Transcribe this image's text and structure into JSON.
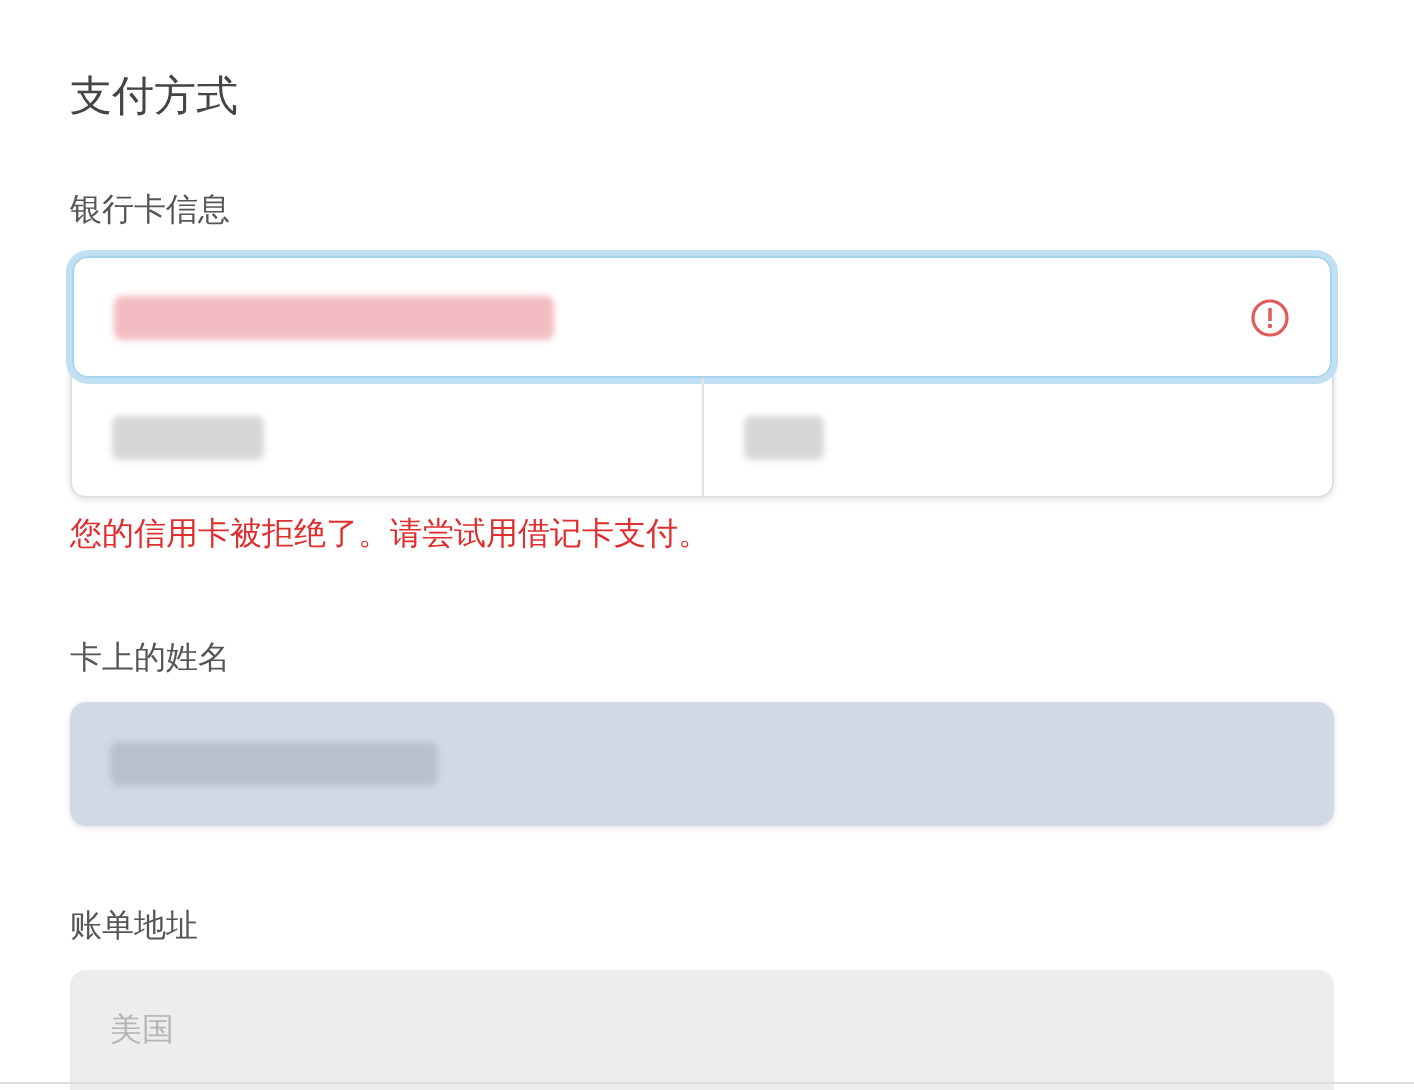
{
  "title": "支付方式",
  "card": {
    "label": "银行卡信息",
    "invalid": true,
    "focused": true,
    "number_redacted": true,
    "expiry_redacted": true,
    "cvc_redacted": true,
    "error": "您的信用卡被拒绝了。请尝试用借记卡支付。"
  },
  "name": {
    "label": "卡上的姓名",
    "autofilled": true,
    "value_redacted": true
  },
  "billing": {
    "label": "账单地址",
    "value": "美国",
    "disabled": true
  }
}
